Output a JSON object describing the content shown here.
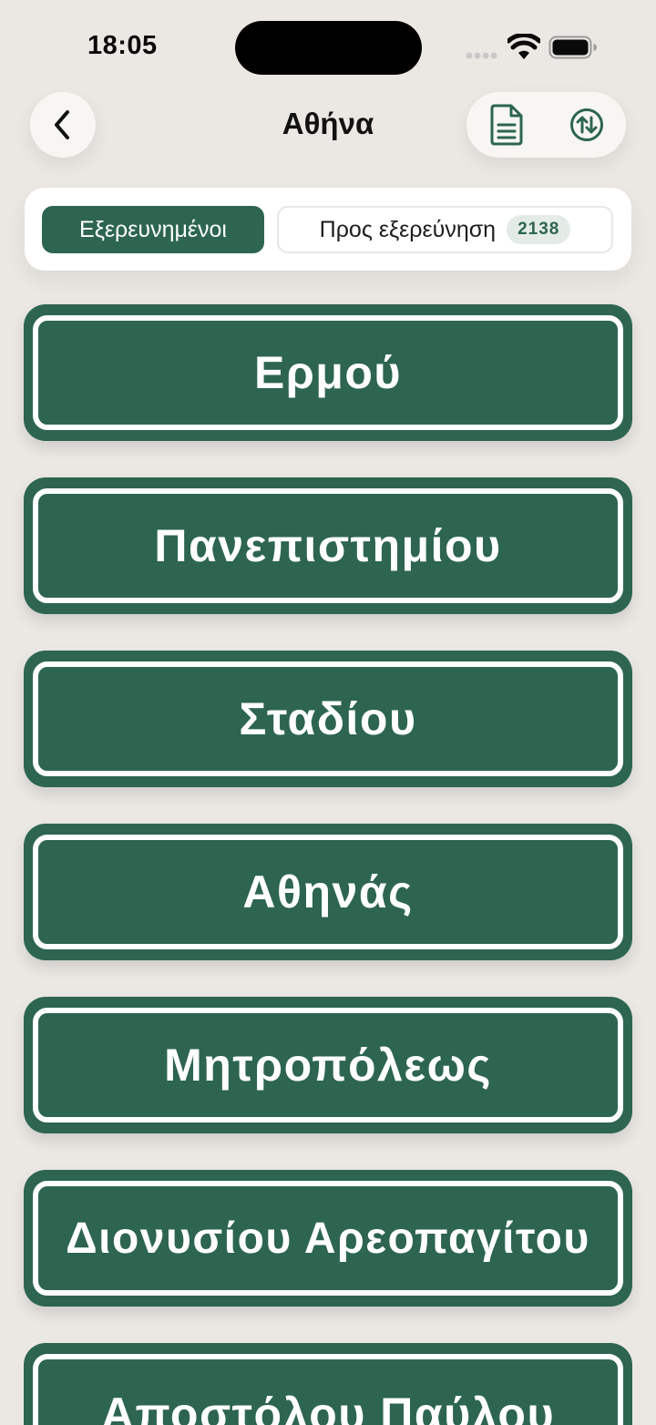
{
  "status_bar": {
    "time": "18:05"
  },
  "header": {
    "title": "Αθήνα",
    "back_icon": "chevron-left-icon",
    "actions": [
      {
        "icon": "document-icon"
      },
      {
        "icon": "sort-arrows-icon"
      }
    ]
  },
  "tabs": {
    "explored_label": "Εξερευνημένοι",
    "to_explore_label": "Προς εξερεύνηση",
    "to_explore_count": "2138",
    "selected": "explored"
  },
  "streets": [
    "Ερμού",
    "Πανεπιστημίου",
    "Σταδίου",
    "Αθηνάς",
    "Μητροπόλεως",
    "Διονυσίου Αρεοπαγίτου",
    "Αποστόλου Παύλου"
  ],
  "colors": {
    "accent": "#2d6550",
    "background": "#ebe8e4",
    "card": "#ffffff"
  }
}
